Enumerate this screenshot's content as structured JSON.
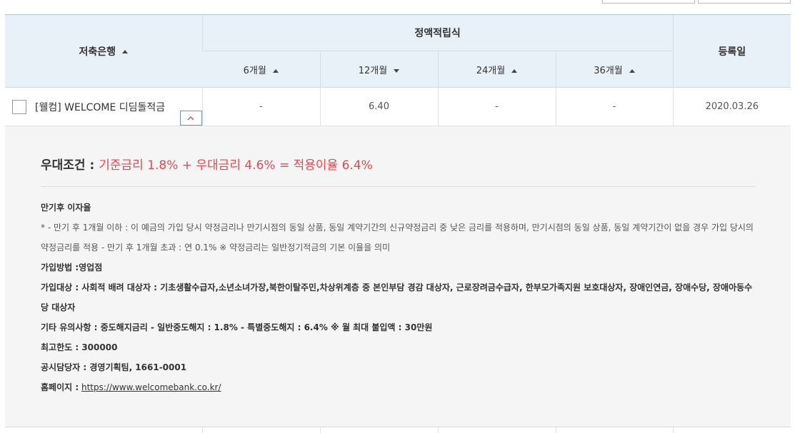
{
  "table": {
    "headers": {
      "bank": "저축은행",
      "group": "정액적립식",
      "registered": "등록일",
      "terms": [
        "6개월",
        "12개월",
        "24개월",
        "36개월"
      ]
    },
    "row": {
      "name": "[웰컴] WELCOME 디딤돌적금",
      "rates": [
        "-",
        "6.40",
        "-",
        "-"
      ],
      "date": "2020.03.26"
    }
  },
  "detail": {
    "title_label": "우대조건 :",
    "title_value": "기준금리 1.8% + 우대금리 4.6% = 적용이율 6.4%",
    "maturity_label": "만기후 이자율",
    "maturity_text": "* - 만기 후 1개월 이하 : 이 예금의 가입 당시 약정금리나 만기시점의 동일 상품, 동일 계약기간의 신규약정금리 중 낮은 금리를 적용하며, 만기시점의 동일 상품, 동일 계약기간이 없을 경우 가입 당시의 약정금리를 적용 - 만기 후 1개월 초과 : 연 0.1% ※ 약정금리는 일반정기적금의 기본 이율을 의미",
    "method_label": "가입방법 :",
    "method_value": "영업점",
    "target_label": "가입대상 :",
    "target_value": " 사회적 배려 대상자 : 기초생활수급자,소년소녀가장,북한이탈주민,차상위계층 중 본인부담 경감 대상자, 근로장려금수급자, 한부모가족지원 보호대상자, 장애인연금, 장애수당, 장애아동수당 대상자",
    "notes_label": "기타 유의사항 :",
    "notes_value": " 중도해지금리 - 일반중도해지 : 1.8% - 특별중도해지 : 6.4% ※ 월 최대 불입액 : 30만원",
    "limit_label": "최고한도 :",
    "limit_value": " 300000",
    "contact_label": "공시담당자 :",
    "contact_value": " 경영기획팀, 1661-0001",
    "homepage_label": "홈페이지 :",
    "homepage_value": "https://www.welcomebank.co.kr/"
  },
  "icons": {
    "sort_asc": "sort-up-icon",
    "sort_desc": "sort-down-icon",
    "toggle": "chevron-up-icon",
    "checkbox": "checkbox-icon"
  },
  "colors": {
    "header_bg": "#e9f1f8",
    "accent_red": "#e8484d",
    "detail_bg": "#f5f5f5",
    "toggle_border": "#6e97bd"
  }
}
